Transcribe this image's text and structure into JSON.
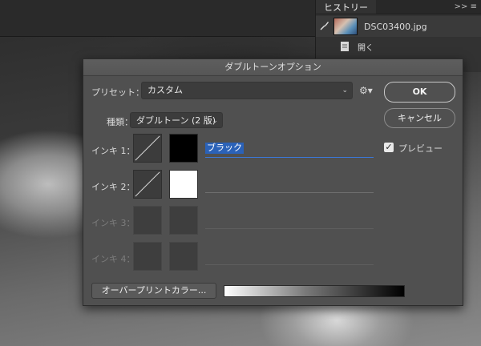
{
  "history": {
    "tab_label": "ヒストリー",
    "controls": ">>  ≡",
    "snapshot_name": "DSC03400.jpg",
    "open_label": "開く"
  },
  "dialog": {
    "title": "ダブルトーンオプション",
    "preset_label": "プリセット：",
    "preset_value": "カスタム",
    "type_label": "種類：",
    "type_value": "ダブルトーン (2 版)",
    "ok_label": "OK",
    "cancel_label": "キャンセル",
    "preview_label": "プレビュー",
    "preview_checked": "✓",
    "overprint_label": "オーバープリントカラー...",
    "inks": [
      {
        "label": "インキ 1：",
        "name": "ブラック",
        "color": "#000000"
      },
      {
        "label": "インキ 2：",
        "name": "",
        "color": "#ffffff"
      },
      {
        "label": "インキ 3：",
        "name": ""
      },
      {
        "label": "インキ 4：",
        "name": ""
      }
    ]
  }
}
